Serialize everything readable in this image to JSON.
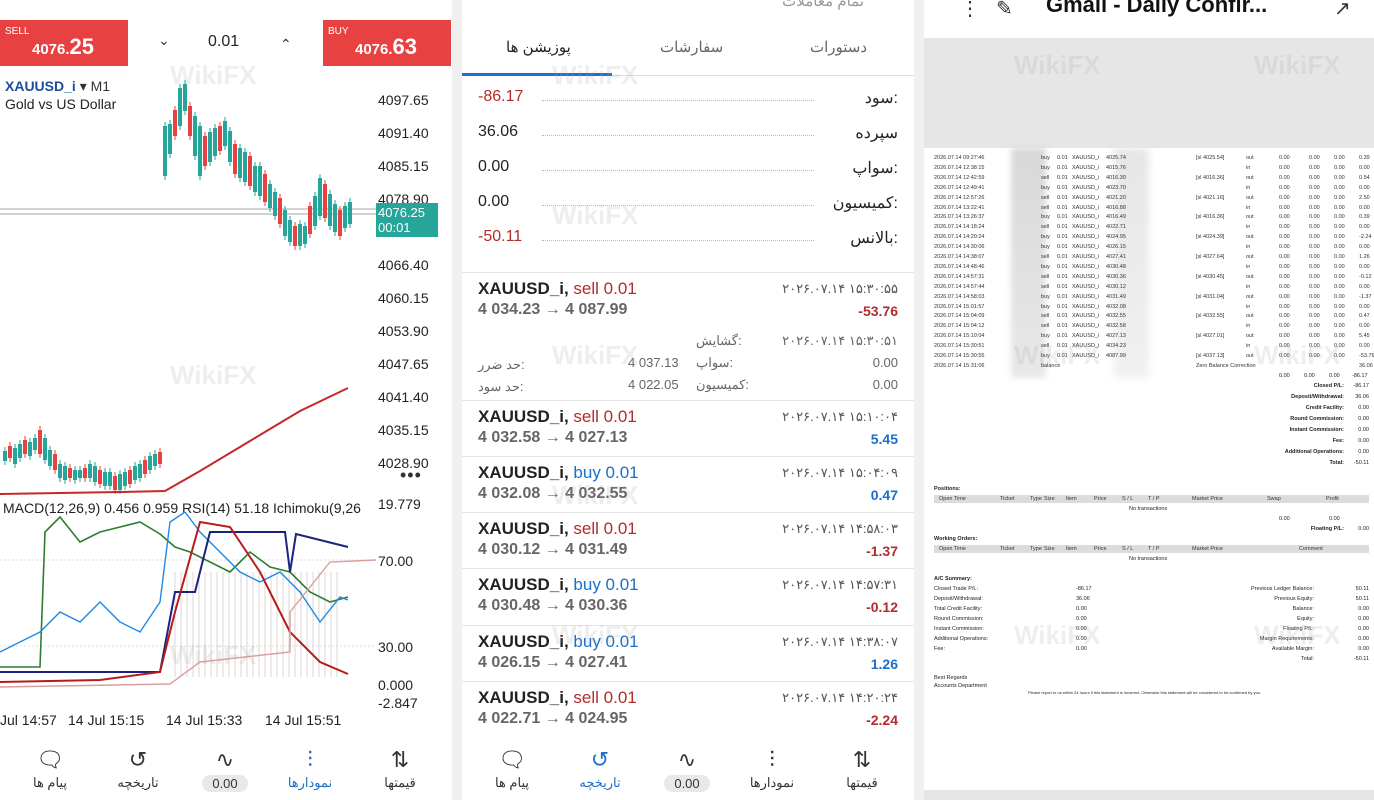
{
  "p1": {
    "sell_label": "SELL",
    "sell_price_main": "4076.",
    "sell_price_big": "25",
    "buy_label": "BUY",
    "buy_price_main": "4076.",
    "buy_price_big": "63",
    "lot": "0.01",
    "symbol": "XAUUSD_i",
    "timeframe": "M1",
    "symbol_desc": "Gold vs US Dollar",
    "price_axis": [
      "4097.65",
      "4091.40",
      "4085.15",
      "4078.90",
      "4066.40",
      "4060.15",
      "4053.90",
      "4047.65",
      "4041.40",
      "4035.15",
      "4028.90"
    ],
    "current_price": "4076.25",
    "current_timer": "00:01",
    "indicator_label": "MACD(12,26,9) 0.456 0.959 RSI(14) 51.18 Ichimoku(9,26",
    "ind_axis": [
      "19.779",
      "70.00",
      "30.00",
      "0.000",
      "-2.847"
    ],
    "x_axis": [
      "Jul 14:57",
      "14 Jul 15:15",
      "14 Jul 15:33",
      "14 Jul 15:51"
    ],
    "nav": [
      "پیام ها",
      "تاریخچه",
      "0.00",
      "نمودارها",
      "قیمتها"
    ]
  },
  "p2": {
    "header_partial": "تمام معاملات",
    "tabs": [
      "دستورات",
      "سفارشات",
      "پوزیشن ها"
    ],
    "summary": [
      {
        "label": "سود:",
        "value": "-86.17"
      },
      {
        "label": "سپرده",
        "value": "36.06"
      },
      {
        "label": "سواپ:",
        "value": "0.00"
      },
      {
        "label": "کمیسیون:",
        "value": "0.00"
      },
      {
        "label": "بالانس:",
        "value": "-50.11"
      }
    ],
    "positions": [
      {
        "sym": "XAUUSD_i,",
        "side": "sell",
        "lot": "0.01",
        "prices": "4 034.23 → 4 087.99",
        "time": "۲۰۲۶.۰۷.۱۴ ۱۵:۳۰:۵۵",
        "pl": "-53.76"
      },
      {
        "sym": "XAUUSD_i,",
        "side": "sell",
        "lot": "0.01",
        "prices": "4 032.58 → 4 027.13",
        "time": "۲۰۲۶.۰۷.۱۴ ۱۵:۱۰:۰۴",
        "pl": "5.45"
      },
      {
        "sym": "XAUUSD_i,",
        "side": "buy",
        "lot": "0.01",
        "prices": "4 032.08 → 4 032.55",
        "time": "۲۰۲۶.۰۷.۱۴ ۱۵:۰۴:۰۹",
        "pl": "0.47"
      },
      {
        "sym": "XAUUSD_i,",
        "side": "sell",
        "lot": "0.01",
        "prices": "4 030.12 → 4 031.49",
        "time": "۲۰۲۶.۰۷.۱۴ ۱۴:۵۸:۰۳",
        "pl": "-1.37"
      },
      {
        "sym": "XAUUSD_i,",
        "side": "buy",
        "lot": "0.01",
        "prices": "4 030.48 → 4 030.36",
        "time": "۲۰۲۶.۰۷.۱۴ ۱۴:۵۷:۳۱",
        "pl": "-0.12"
      },
      {
        "sym": "XAUUSD_i,",
        "side": "buy",
        "lot": "0.01",
        "prices": "4 026.15 → 4 027.41",
        "time": "۲۰۲۶.۰۷.۱۴ ۱۴:۳۸:۰۷",
        "pl": "1.26"
      },
      {
        "sym": "XAUUSD_i,",
        "side": "sell",
        "lot": "0.01",
        "prices": "4 022.71 → 4 024.95",
        "time": "۲۰۲۶.۰۷.۱۴ ۱۴:۲۰:۲۴",
        "pl": "-2.24"
      }
    ],
    "detail": {
      "open_lbl": "گشایش:",
      "open_time": "۲۰۲۶.۰۷.۱۴ ۱۵:۳۰:۵۱",
      "sl_lbl": "حد ضرر:",
      "sl_val": "4 037.13",
      "tp_lbl": "حد سود:",
      "tp_val": "4 022.05",
      "swap_lbl": "سواپ:",
      "swap_val": "0.00",
      "comm_lbl": "کمیسیون:",
      "comm_val": "0.00"
    },
    "nav": [
      "پیام ها",
      "تاریخچه",
      "0.00",
      "نمودارها",
      "قیمتها"
    ]
  },
  "p3": {
    "title": "Gmail - Daily Confir...",
    "rows": [
      [
        "2026.07.14 09:27:46",
        "buy",
        "0.01",
        "XAUUSD_i",
        "4025.74",
        "[sl 4025.54]",
        "out",
        "0.00",
        "0.00",
        "0.00",
        "0.39"
      ],
      [
        "2026.07.14 12:38:15",
        "buy",
        "0.01",
        "XAUUSD_i",
        "4015.76",
        "",
        "in",
        "0.00",
        "0.00",
        "0.00",
        "0.00"
      ],
      [
        "2026.07.14 12:42:59",
        "sell",
        "0.01",
        "XAUUSD_i",
        "4016.30",
        "[sl 4016.36]",
        "out",
        "0.00",
        "0.00",
        "0.00",
        "0.54"
      ],
      [
        "2026.07.14 12:49:41",
        "buy",
        "0.01",
        "XAUUSD_i",
        "4023.70",
        "",
        "in",
        "0.00",
        "0.00",
        "0.00",
        "0.00"
      ],
      [
        "2026.07.14 12:57:26",
        "sell",
        "0.01",
        "XAUUSD_i",
        "4021.20",
        "[sl 4021.16]",
        "out",
        "0.00",
        "0.00",
        "0.00",
        "2.50"
      ],
      [
        "2026.07.14 13:22:41",
        "sell",
        "0.01",
        "XAUUSD_i",
        "4016.88",
        "",
        "in",
        "0.00",
        "0.00",
        "0.00",
        "0.00"
      ],
      [
        "2026.07.14 13:26:37",
        "buy",
        "0.01",
        "XAUUSD_i",
        "4016.49",
        "[sl 4016.36]",
        "out",
        "0.00",
        "0.00",
        "0.00",
        "0.39"
      ],
      [
        "2026.07.14 14:18:24",
        "sell",
        "0.01",
        "XAUUSD_i",
        "4022.71",
        "",
        "in",
        "0.00",
        "0.00",
        "0.00",
        "0.00"
      ],
      [
        "2026.07.14 14:20:24",
        "buy",
        "0.01",
        "XAUUSD_i",
        "4024.95",
        "[sl 4024.39]",
        "out",
        "0.00",
        "0.00",
        "0.00",
        "-2.24"
      ],
      [
        "2026.07.14 14:30:06",
        "buy",
        "0.01",
        "XAUUSD_i",
        "4026.15",
        "",
        "in",
        "0.00",
        "0.00",
        "0.00",
        "0.00"
      ],
      [
        "2026.07.14 14:38:07",
        "sell",
        "0.01",
        "XAUUSD_i",
        "4027.41",
        "[sl 4027.64]",
        "out",
        "0.00",
        "0.00",
        "0.00",
        "1.26"
      ],
      [
        "2026.07.14 14:48:46",
        "buy",
        "0.01",
        "XAUUSD_i",
        "4030.48",
        "",
        "in",
        "0.00",
        "0.00",
        "0.00",
        "0.00"
      ],
      [
        "2026.07.14 14:57:31",
        "sell",
        "0.01",
        "XAUUSD_i",
        "4030.36",
        "[sl 4030.45]",
        "out",
        "0.00",
        "0.00",
        "0.00",
        "-0.12"
      ],
      [
        "2026.07.14 14:57:44",
        "sell",
        "0.01",
        "XAUUSD_i",
        "4030.12",
        "",
        "in",
        "0.00",
        "0.00",
        "0.00",
        "0.00"
      ],
      [
        "2026.07.14 14:58:03",
        "buy",
        "0.01",
        "XAUUSD_i",
        "4031.49",
        "[sl 4031.04]",
        "out",
        "0.00",
        "0.00",
        "0.00",
        "-1.37"
      ],
      [
        "2026.07.14 15:01:57",
        "buy",
        "0.01",
        "XAUUSD_i",
        "4032.08",
        "",
        "in",
        "0.00",
        "0.00",
        "0.00",
        "0.00"
      ],
      [
        "2026.07.14 15:04:09",
        "sell",
        "0.01",
        "XAUUSD_i",
        "4032.55",
        "[sl 4032.55]",
        "out",
        "0.00",
        "0.00",
        "0.00",
        "0.47"
      ],
      [
        "2026.07.14 15:04:12",
        "sell",
        "0.01",
        "XAUUSD_i",
        "4032.58",
        "",
        "in",
        "0.00",
        "0.00",
        "0.00",
        "0.00"
      ],
      [
        "2026.07.14 15:10:04",
        "buy",
        "0.01",
        "XAUUSD_i",
        "4027.13",
        "[sl 4027.01]",
        "out",
        "0.00",
        "0.00",
        "0.00",
        "5.45"
      ],
      [
        "2026.07.14 15:30:51",
        "sell",
        "0.01",
        "XAUUSD_i",
        "4034.23",
        "",
        "in",
        "0.00",
        "0.00",
        "0.00",
        "0.00"
      ],
      [
        "2026.07.14 15:30:55",
        "buy",
        "0.01",
        "XAUUSD_i",
        "4087.99",
        "[sl 4037.13]",
        "out",
        "0.00",
        "0.00",
        "0.00",
        "-53.76"
      ],
      [
        "2026.07.14 15:31:06",
        "balance",
        "",
        "",
        "",
        "Zero Balance Correction",
        "",
        "",
        "",
        "",
        "36.06"
      ]
    ],
    "totals_row": [
      "0.00",
      "0.00",
      "0.00",
      "-86.17"
    ],
    "summary": [
      [
        "Closed P/L:",
        "-86.17"
      ],
      [
        "Deposit/Withdrawal:",
        "36.06"
      ],
      [
        "Credit Facility:",
        "0.00"
      ],
      [
        "Round Commission:",
        "0.00"
      ],
      [
        "Instant Commission:",
        "0.00"
      ],
      [
        "Fee:",
        "0.00"
      ],
      [
        "Additional Operations:",
        "0.00"
      ],
      [
        "Total:",
        "-50.11"
      ]
    ],
    "positions_title": "Positions:",
    "pos_headers": [
      "Open Time",
      "Ticket",
      "Type",
      "Size",
      "Item",
      "Price",
      "S / L",
      "T / P",
      "Market Price",
      "Swap",
      "Profit"
    ],
    "no_tx": "No transactions",
    "pos_zero": [
      "0.00",
      "0.00"
    ],
    "floating": [
      "Floating P/L:",
      "0.00"
    ],
    "working_title": "Working Orders:",
    "wo_headers": [
      "Open Time",
      "Ticket",
      "Type",
      "Size",
      "Item",
      "Price",
      "S / L",
      "T / P",
      "Market Price",
      "Comment"
    ],
    "ac_title": "A/C Summary:",
    "ac_left": [
      [
        "Closed Trade P/L:",
        "-86.17"
      ],
      [
        "Deposit/Withdrawal:",
        "36.06"
      ],
      [
        "Total Credit Facility:",
        "0.00"
      ],
      [
        "Round Commission:",
        "0.00"
      ],
      [
        "Instant Commission:",
        "0.00"
      ],
      [
        "Additional Operations:",
        "0.00"
      ],
      [
        "Fee:",
        "0.00"
      ]
    ],
    "ac_right": [
      [
        "Previous Ledger Balance:",
        "50.11"
      ],
      [
        "Previous Equity:",
        "50.11"
      ],
      [
        "Balance:",
        "0.00"
      ],
      [
        "Equity:",
        "0.00"
      ],
      [
        "Floating P/L:",
        "0.00"
      ],
      [
        "Margin Requirements:",
        "0.00"
      ],
      [
        "Available Margin:",
        "0.00"
      ],
      [
        "Total:",
        "-50.11"
      ]
    ],
    "regards": "Best Regards",
    "dept": "Accounts Department",
    "footer": "Please report to us within 24 hours if this statement is incorrect. Otherwise this statement will be considered to be confirmed by you."
  },
  "watermark": "WikiFX"
}
